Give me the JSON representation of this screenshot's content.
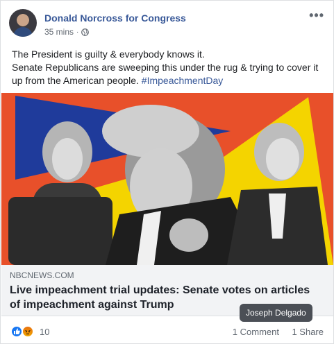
{
  "post": {
    "page_name": "Donald Norcross for Congress",
    "time": "35 mins",
    "dot": "·",
    "more": "•••",
    "text_line1": "The President is guilty & everybody knows it.",
    "text_line2": "Senate Republicans are sweeping this under the rug & trying to cover it up from the American people.",
    "hashtag": "#ImpeachmentDay"
  },
  "link": {
    "domain": "NBCNEWS.COM",
    "headline": "Live impeachment trial updates: Senate votes on articles of impeachment against Trump"
  },
  "tooltip": {
    "name": "Joseph Delgado"
  },
  "footer": {
    "reaction_count": "10",
    "comments": "1 Comment",
    "shares": "1 Share",
    "reactions": [
      "like-icon",
      "angry-icon"
    ]
  },
  "colors": {
    "brand_link": "#385898",
    "image_background": "#e8502a",
    "image_yellow": "#f4d400",
    "image_blue": "#1f3b9b"
  }
}
